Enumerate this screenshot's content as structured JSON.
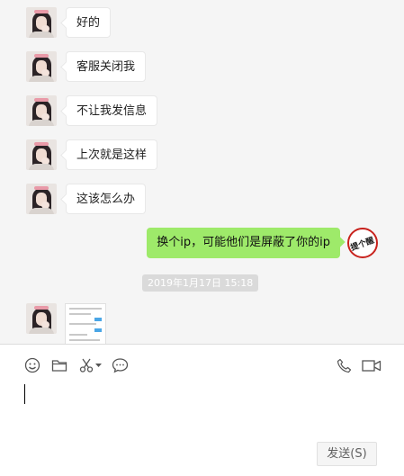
{
  "incoming_messages": [
    {
      "text": "好的"
    },
    {
      "text": "客服关闭我"
    },
    {
      "text": "不让我发信息"
    },
    {
      "text": "上次就是这样"
    },
    {
      "text": "这该怎么办"
    }
  ],
  "outgoing_message": {
    "text": "换个ip，可能他们是屏蔽了你的ip",
    "stamp_text": "提个醒"
  },
  "timestamp": "2019年1月17日 15:18",
  "composer": {
    "send_label": "发送(S)",
    "tools_left": [
      "emoji-icon",
      "folder-icon",
      "scissors-icon",
      "chevron-down-icon",
      "chat-bubble-icon"
    ],
    "tools_right": [
      "phone-icon",
      "video-icon"
    ]
  },
  "colors": {
    "outgoing_bubble": "#9eea6a",
    "chat_bg": "#f5f5f5",
    "stamp": "#c8221d"
  }
}
